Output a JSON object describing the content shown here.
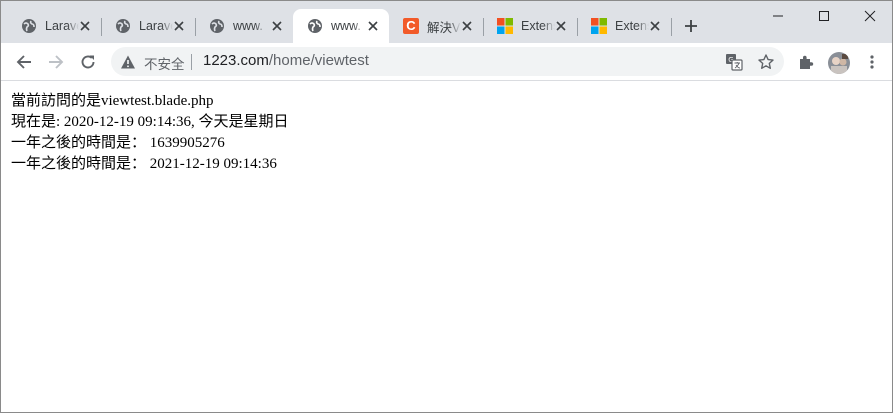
{
  "tabs": [
    {
      "title": "Laravel",
      "icon": "globe-icon"
    },
    {
      "title": "Laravel",
      "icon": "globe-icon"
    },
    {
      "title": "www.",
      "icon": "globe-icon"
    },
    {
      "title": "www.",
      "icon": "globe-icon",
      "active": true
    },
    {
      "title": "解決V",
      "icon": "c-logo-icon",
      "icon_glyph": "C"
    },
    {
      "title": "Extens",
      "icon": "microsoft-logo-icon"
    },
    {
      "title": "Extens",
      "icon": "microsoft-logo-icon"
    }
  ],
  "toolbar": {
    "security_label": "不安全",
    "url_host": "1223.com",
    "url_path": "/home/viewtest"
  },
  "page": {
    "lines": [
      "當前訪問的是viewtest.blade.php",
      "現在是: 2020-12-19 09:14:36, 今天是星期日",
      "一年之後的時間是： 1639905276",
      "一年之後的時間是： 2021-12-19 09:14:36"
    ]
  },
  "colors": {
    "tabstrip_bg": "#dee1e6",
    "active_tab_bg": "#ffffff",
    "omnibox_bg": "#f1f3f4",
    "c_logo_bg": "#f25a29",
    "ms_red": "#f25022",
    "ms_green": "#7fba00",
    "ms_blue": "#00a4ef",
    "ms_yellow": "#ffb900"
  }
}
